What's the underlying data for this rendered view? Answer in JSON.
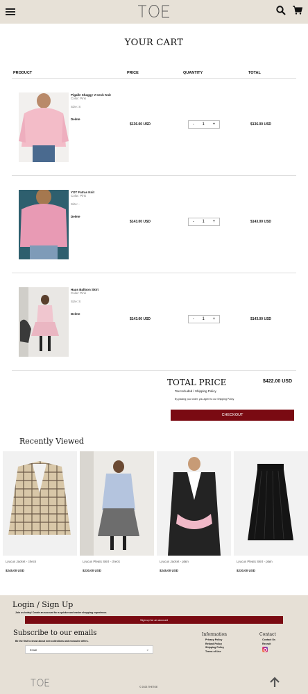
{
  "header": {
    "logo_text": "TOE",
    "menu_icon": "hamburger-icon",
    "search_icon": "search-icon",
    "cart_icon": "cart-icon"
  },
  "cart": {
    "title": "YOUR CART",
    "columns": {
      "product": "PRODUCT",
      "price": "PRICE",
      "quantity": "QUANTITY",
      "total": "TOTAL"
    },
    "items": [
      {
        "name": "Pigalle Shaggy V-neck Knit",
        "color": "Color: Pink",
        "size": "Size: S",
        "delete": "Delete",
        "price": "$136.00 USD",
        "qty": "1",
        "total": "$136.00 USD",
        "minus": "-",
        "plus": "+"
      },
      {
        "name": "YOT Fatras Knit",
        "color": "Color: Pink",
        "size": "Size: -",
        "delete": "Delete",
        "price": "$143.00 USD",
        "qty": "1",
        "total": "$143.00 USD",
        "minus": "-",
        "plus": "+"
      },
      {
        "name": "Haus Balloon Skirt",
        "color": "Color: Pink",
        "size": "Size: S",
        "delete": "Delete",
        "price": "$143.00 USD",
        "qty": "1",
        "total": "$143.00 USD",
        "minus": "-",
        "plus": "+"
      }
    ],
    "total_label": "TOTAL PRICE",
    "total_amount": "$422.00 USD",
    "tax_note": "Tax Included / Shipping Policy",
    "agree_note": "By placing your order, you agree to our Shipping Policy",
    "checkout": "CHECKOUT"
  },
  "recently_viewed": {
    "title": "Recently Viewed",
    "items": [
      {
        "name": "Lyucus Jacket - check",
        "price": "$245.00 USD"
      },
      {
        "name": "Lyucus Pleats Skirt - check",
        "price": "$230.00 USD"
      },
      {
        "name": "Lyucus Jacket - plain",
        "price": "$245.00 USD"
      },
      {
        "name": "Lyucus Pleats Skirt - plain",
        "price": "$230.00 USD"
      }
    ]
  },
  "footer": {
    "login_title": "Login / Sign Up",
    "join_text": "Join us today! Create an account for a quicker and easier shopping experience.",
    "signup_button": "Sign up for an account",
    "subscribe_title": "Subscribe to our emails",
    "subscribe_text": "Be the first to know about new collections and exclusive offers.",
    "email_placeholder": "Email",
    "email_arrow": ">",
    "info_title": "Information",
    "info_links": [
      "Privacy Policy",
      "Refund Policy",
      "Shipping Policy",
      "Terms of Use"
    ],
    "contact_title": "Contact",
    "contact_links": [
      "Contact Us",
      "Recruit"
    ],
    "logo_text": "TOE",
    "copyright": "© 2023 THETOE"
  }
}
